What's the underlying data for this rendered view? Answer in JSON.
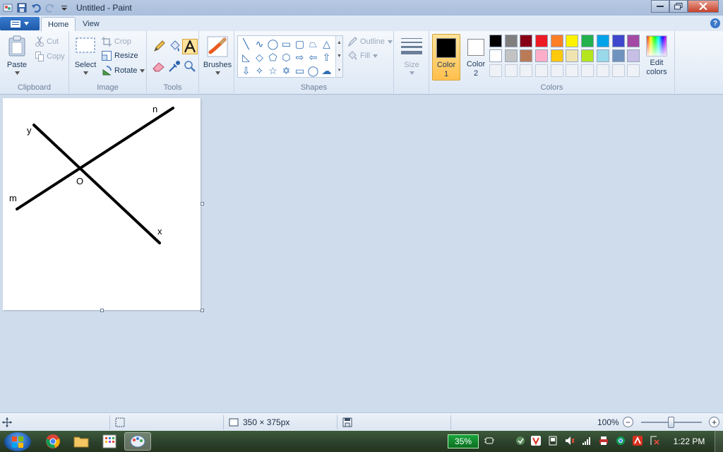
{
  "window": {
    "title": "Untitled - Paint"
  },
  "tabs": [
    {
      "label": "Home"
    },
    {
      "label": "View"
    }
  ],
  "ribbon": {
    "clipboard": {
      "label": "Clipboard",
      "paste": "Paste",
      "cut": "Cut",
      "copy": "Copy"
    },
    "image": {
      "label": "Image",
      "select": "Select",
      "crop": "Crop",
      "resize": "Resize",
      "rotate": "Rotate"
    },
    "tools": {
      "label": "Tools"
    },
    "brushes": {
      "label": "Brushes"
    },
    "shapes": {
      "label": "Shapes",
      "outline": "Outline",
      "fill": "Fill"
    },
    "size": {
      "label": "Size"
    },
    "colors": {
      "label": "Colors",
      "color1_line1": "Color",
      "color1_line2": "1",
      "color2_line1": "Color",
      "color2_line2": "2",
      "edit_line1": "Edit",
      "edit_line2": "colors",
      "color1": "#000000",
      "color2": "#ffffff",
      "palette": [
        "#000000",
        "#7f7f7f",
        "#880015",
        "#ed1c24",
        "#ff7f27",
        "#fff200",
        "#22b14c",
        "#00a2e8",
        "#3f48cc",
        "#a349a4",
        "#ffffff",
        "#c3c3c3",
        "#b97a57",
        "#ffaec9",
        "#ffc90e",
        "#efe4b0",
        "#b5e61d",
        "#99d9ea",
        "#7092be",
        "#c8bfe7"
      ]
    }
  },
  "canvas": {
    "labels": {
      "y": "y",
      "n": "n",
      "o": "O",
      "m": "m",
      "x": "x"
    }
  },
  "statusbar": {
    "dimensions": "350 × 375px",
    "zoom": "100%"
  },
  "taskbar": {
    "battery": "35%",
    "clock": "1:22 PM"
  }
}
